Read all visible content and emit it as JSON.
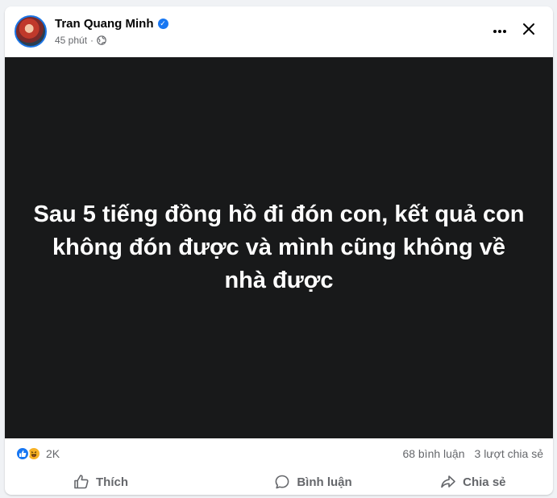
{
  "post": {
    "author": "Tran Quang Minh",
    "verified_mark": "✓",
    "time": "45 phút",
    "meta_separator": "·",
    "image_text": "Sau 5 tiếng đồng hồ đi đón con, kết quả con không đón được và mình cũng không về nhà được"
  },
  "stats": {
    "reaction_count": "2K",
    "comments": "68 bình luận",
    "shares": "3 lượt chia sẻ"
  },
  "actions": {
    "like": "Thích",
    "comment": "Bình luận",
    "share": "Chia sẻ"
  },
  "icons": [
    "more-icon",
    "close-icon",
    "globe-icon",
    "like-icon",
    "haha-icon",
    "comment-icon",
    "share-icon"
  ],
  "colors": {
    "accent": "#1877f2",
    "media_background": "#18191a",
    "secondary_text": "#65676b"
  }
}
